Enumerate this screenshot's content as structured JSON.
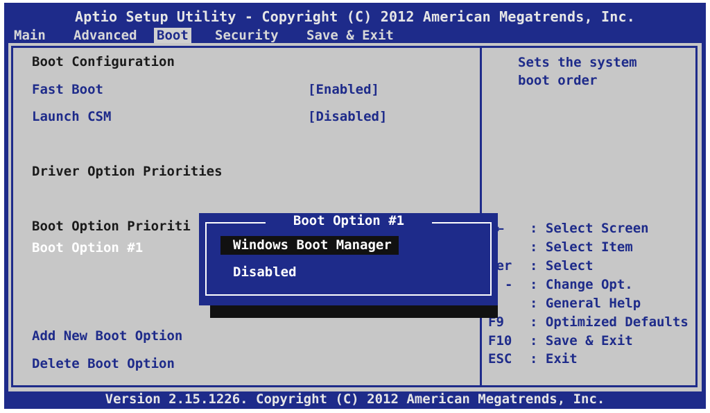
{
  "window": {
    "title": "Aptio Setup Utility - Copyright (C) 2012 American Megatrends, Inc.",
    "footer": "Version 2.15.1226. Copyright (C) 2012 American Megatrends, Inc."
  },
  "menu": {
    "items": [
      "Main",
      "Advanced",
      "Boot",
      "Security",
      "Save & Exit"
    ],
    "active": "Boot"
  },
  "left": {
    "boot_config_header": "Boot Configuration",
    "fast_boot": {
      "label": "Fast Boot",
      "value": "[Enabled]"
    },
    "launch_csm": {
      "label": "Launch CSM",
      "value": "[Disabled]"
    },
    "driver_header": "Driver Option Priorities",
    "boot_prio_header": "Boot Option Prioriti",
    "boot_option_1": "Boot Option #1",
    "add_boot": "Add New Boot Option",
    "delete_boot": "Delete Boot Option"
  },
  "help": {
    "line1": "Sets the system",
    "line2": "boot order"
  },
  "keys": [
    {
      "key": "→←",
      "desc": ": Select Screen"
    },
    {
      "key": "↓",
      "desc": ": Select Item"
    },
    {
      "key": "ter",
      "desc": ": Select"
    },
    {
      "key": "-",
      "desc": ": Change Opt."
    },
    {
      "key": "",
      "desc": ": General Help"
    },
    {
      "key": "F9",
      "desc": ": Optimized Defaults"
    },
    {
      "key": "F10",
      "desc": ": Save & Exit"
    },
    {
      "key": "ESC",
      "desc": ": Exit"
    }
  ],
  "dialog": {
    "title": "Boot Option #1",
    "options": [
      "Windows Boot Manager",
      "Disabled"
    ],
    "selected": "Windows Boot Manager"
  },
  "colors": {
    "bios_blue": "#1e2b8a",
    "panel_gray": "#c7c7c7",
    "selected_black": "#111111"
  }
}
